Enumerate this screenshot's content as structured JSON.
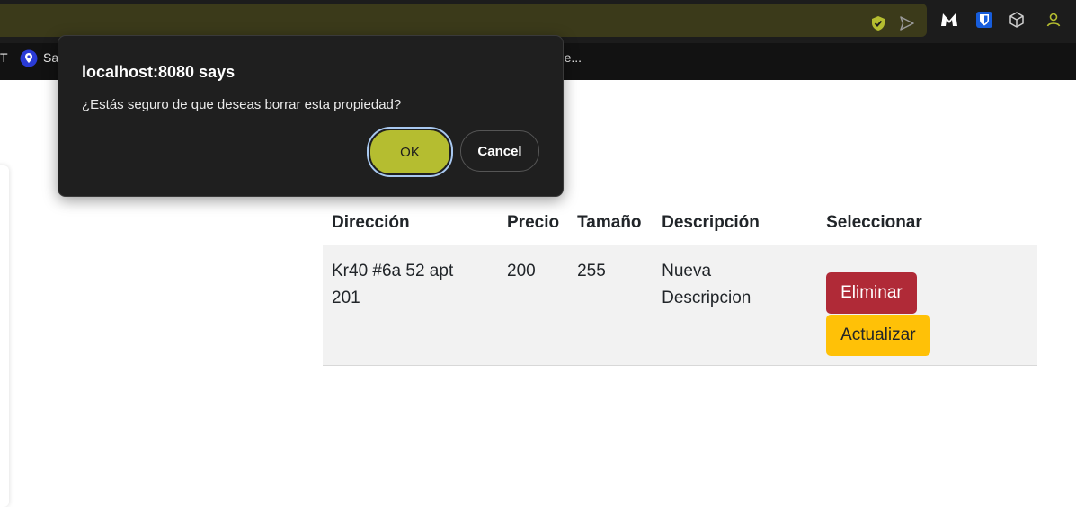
{
  "browser": {
    "bookmark_left": "T",
    "bookmark_item": "Sa",
    "bookmark_right": "ade...",
    "colors": {
      "toolbar": "#1c1c1c",
      "urlbar": "#3b3a1a",
      "bookmarks": "#121212"
    },
    "icons": [
      "shield-check-icon",
      "send-icon",
      "malwarebytes-icon",
      "bitwarden-icon",
      "cube-icon",
      "profile-icon",
      "location-pin-icon"
    ]
  },
  "dialog": {
    "title": "localhost:8080 says",
    "message": "¿Estás seguro de que deseas borrar esta propiedad?",
    "ok_label": "OK",
    "cancel_label": "Cancel",
    "colors": {
      "ok": "#b5bd30",
      "background": "#1f1f1f"
    }
  },
  "table": {
    "headers": [
      "Dirección",
      "Precio",
      "Tamaño",
      "Descripción",
      "Seleccionar"
    ],
    "rows": [
      {
        "direccion": "Kr40 #6a 52 apt 201",
        "precio": "200",
        "tamano": "255",
        "descripcion": "Nueva Descripcion",
        "delete_label": "Eliminar",
        "update_label": "Actualizar"
      }
    ],
    "colors": {
      "delete": "#b02a37",
      "update": "#ffc107"
    }
  }
}
